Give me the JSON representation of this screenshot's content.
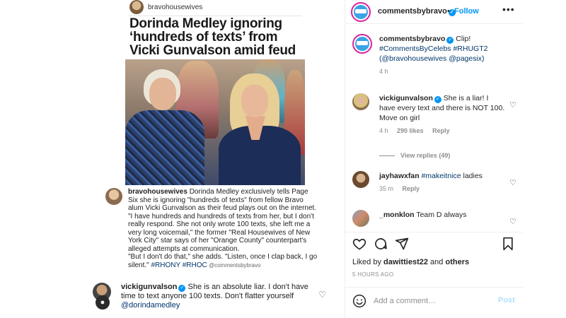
{
  "post_image": {
    "source_handle": "bravohousewives",
    "headline": "Dorinda Medley ignoring ‘hundreds of texts’ from Vicki Gunvalson amid feud",
    "caption": {
      "username": "bravohousewives",
      "text1": " Dorinda Medley exclusively tells Page Six she is ignoring \"hundreds of texts\" from fellow Bravo alum Vicki Gunvalson as their feud plays out on the internet.",
      "text2": "\"I have hundreds and hundreds of texts from her, but I don't really respond. She not only wrote 100 texts, she left me a very long voicemail,\" the former \"Real Housewives of New York City\" star says of her \"Orange County\" counterpart's alleged attempts at communication.",
      "text3": "\"But I don't do that,\" she adds. \"Listen, once I clap back, I go silent.\" ",
      "tags": "#RHONY #RHOC",
      "credit": " @commentsbybravo"
    },
    "embedded_comment": {
      "username": "vickigunvalson",
      "text": " She is an absolute liar.  I don't have time to text anyone 100 texts.  Don't flatter yourself ",
      "mention": "@dorindamedley"
    }
  },
  "panel": {
    "header": {
      "username": "commentsbybravo",
      "separator": "•",
      "follow_label": "Follow",
      "more_label": "•••"
    },
    "comments": [
      {
        "username": "commentsbybravo",
        "text": " Clip! ",
        "tags": "#CommentsByCelebs #RHUGT2 (@bravohousewives @pagesix)",
        "time": "4 h"
      },
      {
        "username": "vickigunvalson",
        "text": " She is a liar! I have every text and there is NOT 100. Move on girl",
        "time": "4 h",
        "likes": "290 likes",
        "reply": "Reply",
        "view_replies": "View replies (49)"
      },
      {
        "username": "jayhawxfan",
        "tags": " #makeitnice",
        "text": " ladies",
        "time": "35 m",
        "reply": "Reply"
      },
      {
        "username": "_monklon",
        "text": " Team D always"
      }
    ],
    "likes_prefix": "Liked by ",
    "likes_user": "dawittiest22",
    "likes_joiner": " and ",
    "likes_others": "others",
    "timestamp": "5 HOURS AGO",
    "comment_placeholder": "Add a comment…",
    "post_label": "Post"
  }
}
